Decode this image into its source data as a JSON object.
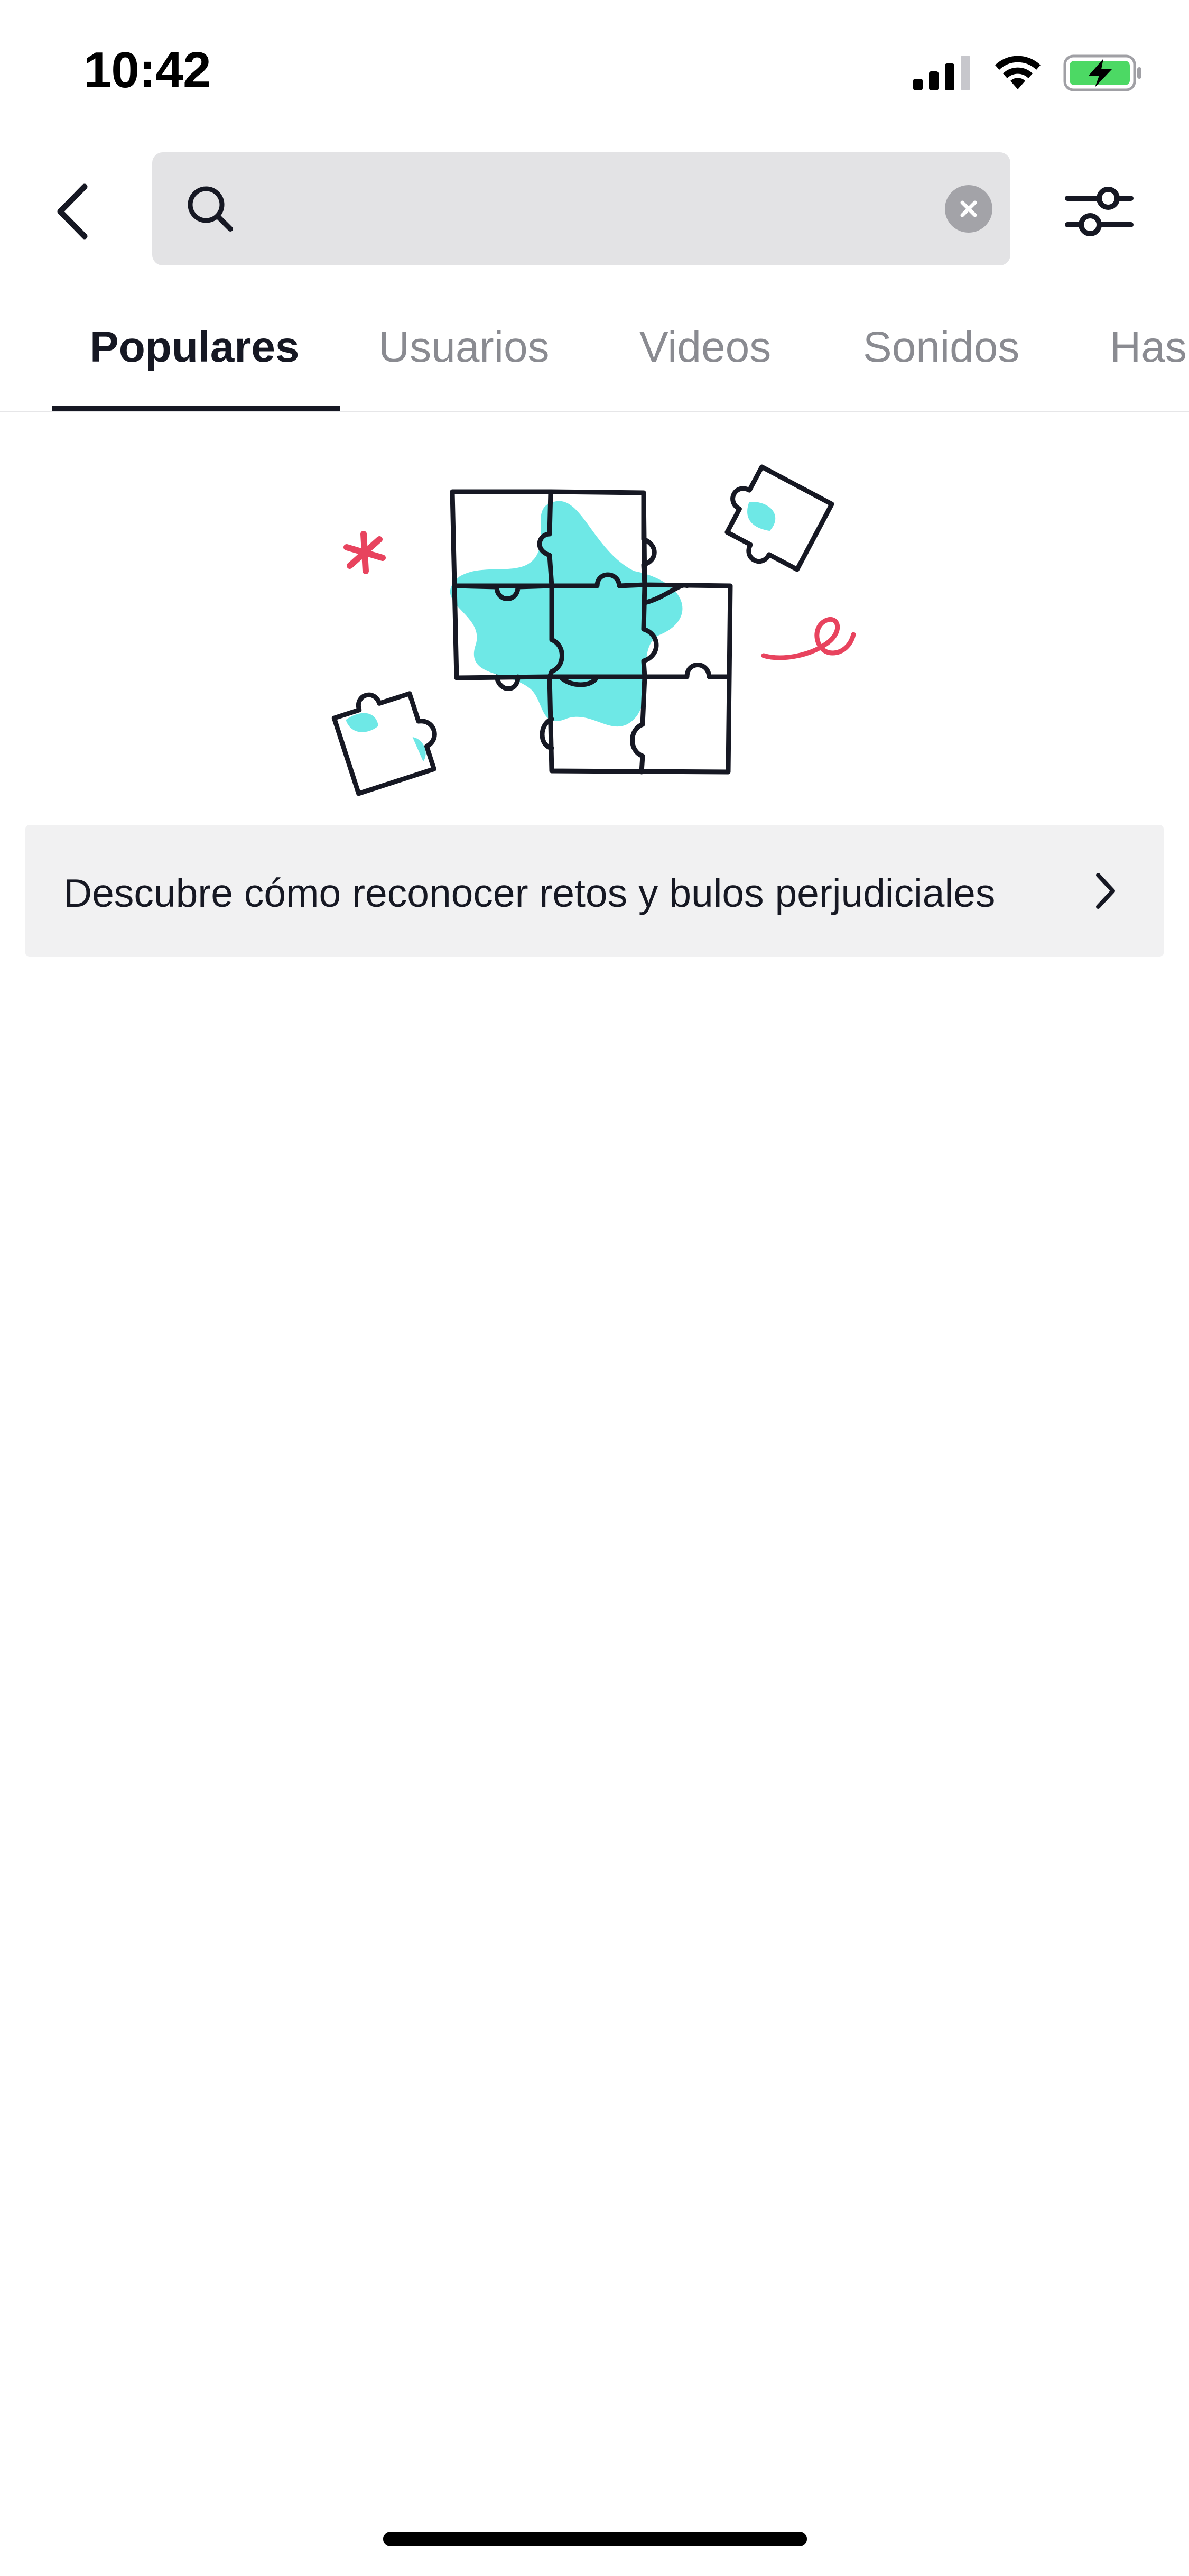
{
  "status_bar": {
    "time": "10:42",
    "icons": [
      "cellular-signal-icon",
      "wifi-icon",
      "battery-charging-icon"
    ],
    "battery_color": "#4cd964"
  },
  "search": {
    "value": "",
    "placeholder": "",
    "icons": {
      "back": "back-arrow-icon",
      "search": "search-icon",
      "clear": "clear-icon",
      "filter": "filter-sliders-icon"
    }
  },
  "tabs": [
    {
      "label": "Populares",
      "active": true
    },
    {
      "label": "Usuarios",
      "active": false
    },
    {
      "label": "Videos",
      "active": false
    },
    {
      "label": "Sonidos",
      "active": false
    },
    {
      "label": "Hashtags",
      "active": false
    }
  ],
  "illustration": {
    "icon": "puzzle-illustration",
    "colors": {
      "accent": "#6ee8e6",
      "highlight": "#e8435e",
      "stroke": "#161823"
    }
  },
  "banner": {
    "text": "Descubre cómo reconocer retos y bulos perjudiciales",
    "icon": "chevron-right-icon"
  }
}
